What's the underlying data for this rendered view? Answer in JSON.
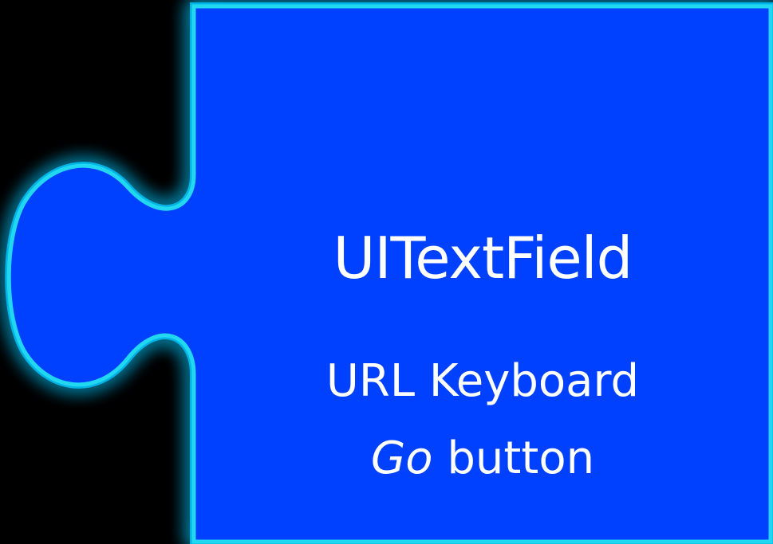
{
  "piece": {
    "fill_color": "#0040ff",
    "outline_color": "#22d8f0",
    "glow_color": "#00c8ff",
    "background_color": "#000000"
  },
  "text": {
    "title": "UITextField",
    "line1": "URL Keyboard",
    "line2_italic": "Go",
    "line2_rest": " button"
  }
}
